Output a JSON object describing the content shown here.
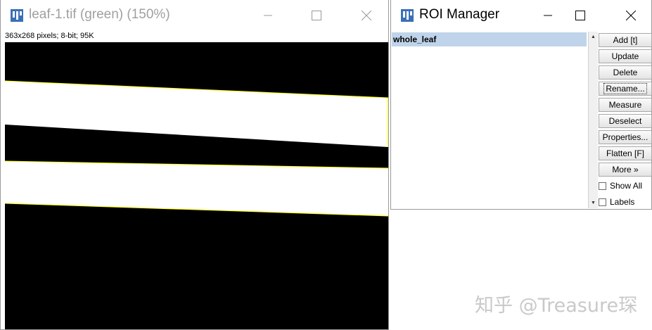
{
  "image_window": {
    "title": "leaf-1.tif (green) (150%)",
    "info": "363x268 pixels; 8-bit; 95K",
    "controls": {
      "minimize": "─",
      "maximize": "☐",
      "close": "✕"
    }
  },
  "roi_manager": {
    "title": "ROI Manager",
    "controls": {
      "minimize": "─",
      "maximize": "☐",
      "close": "✕"
    },
    "items": [
      "whole_leaf"
    ],
    "buttons": [
      "Add [t]",
      "Update",
      "Delete",
      "Rename...",
      "Measure",
      "Deselect",
      "Properties...",
      "Flatten [F]",
      "More »"
    ],
    "checkboxes": [
      "Show All",
      "Labels"
    ]
  },
  "watermark": "知乎 @Treasure琛",
  "colors": {
    "accent_icon": "#3b6fb6",
    "selection": "#bfd4ea",
    "roi_outline": "#ffff00"
  }
}
